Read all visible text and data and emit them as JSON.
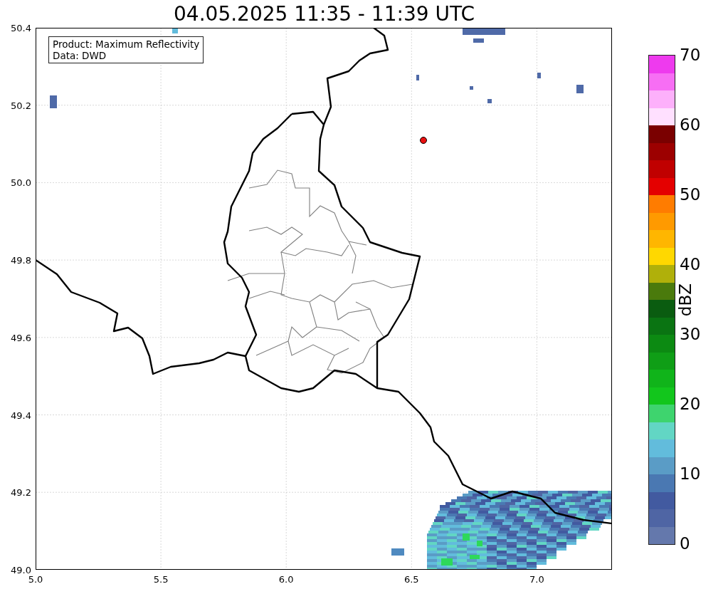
{
  "title": "04.05.2025 11:35 - 11:39 UTC",
  "legend": {
    "lines": [
      "Product: Maximum Reflectivity",
      "Data: DWD"
    ]
  },
  "x_ticks": [
    "5.0",
    "5.5",
    "6.0",
    "6.5",
    "7.0"
  ],
  "y_ticks": [
    "50.4",
    "50.2",
    "50.0",
    "49.8",
    "49.6",
    "49.4",
    "49.2",
    "49.0"
  ],
  "colorbar": {
    "label": "dBZ",
    "ticks": [
      "70",
      "60",
      "50",
      "40",
      "30",
      "20",
      "10",
      "0"
    ],
    "bands": [
      {
        "color": "#6478ac"
      },
      {
        "color": "#4f65a4"
      },
      {
        "color": "#425aa0"
      },
      {
        "color": "#4a78b2"
      },
      {
        "color": "#5a9cc6"
      },
      {
        "color": "#62bcdc"
      },
      {
        "color": "#62d6c4"
      },
      {
        "color": "#3ed46e"
      },
      {
        "color": "#12c61c"
      },
      {
        "color": "#10b41a"
      },
      {
        "color": "#0f9e16"
      },
      {
        "color": "#0c8a12"
      },
      {
        "color": "#0a7412"
      },
      {
        "color": "#0a5c10"
      },
      {
        "color": "#4a7a0c"
      },
      {
        "color": "#b0b00a"
      },
      {
        "color": "#ffd800"
      },
      {
        "color": "#ffb600"
      },
      {
        "color": "#ff9a00"
      },
      {
        "color": "#ff7c00"
      },
      {
        "color": "#e40000"
      },
      {
        "color": "#c00000"
      },
      {
        "color": "#9c0000"
      },
      {
        "color": "#7a0000"
      },
      {
        "color": "#ffe0ff"
      },
      {
        "color": "#fdb0fb"
      },
      {
        "color": "#f76ef4"
      },
      {
        "color": "#ee3aee"
      }
    ]
  }
}
